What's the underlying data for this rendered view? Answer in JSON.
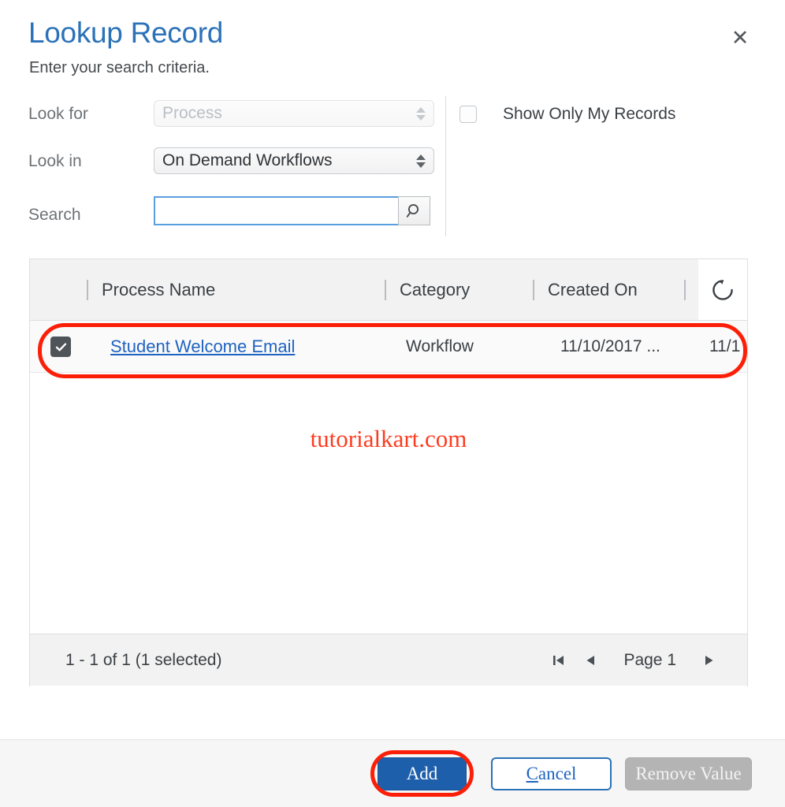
{
  "dialog": {
    "title": "Lookup Record",
    "subtitle": "Enter your search criteria.",
    "close_label": "✕"
  },
  "criteria": {
    "look_for": {
      "label": "Look for",
      "value": "Process",
      "disabled": true
    },
    "look_in": {
      "label": "Look in",
      "value": "On Demand Workflows",
      "disabled": false
    },
    "search": {
      "label": "Search",
      "value": "",
      "placeholder": ""
    },
    "show_only_my_records": {
      "label": "Show Only My Records",
      "checked": false
    }
  },
  "grid": {
    "columns": [
      "Process Name",
      "Category",
      "Created On"
    ],
    "rows": [
      {
        "selected": true,
        "process_name": "Student Welcome Email",
        "category": "Workflow",
        "created_on": "11/10/2017 ...",
        "extra": "11/1"
      }
    ],
    "refresh_icon": "refresh-icon",
    "footer": {
      "count": "1 - 1 of 1 (1 selected)",
      "page_label": "Page 1",
      "first_icon": "first-page-icon",
      "prev_icon": "previous-page-icon",
      "next_icon": "next-page-icon"
    }
  },
  "watermark": "tutorialkart.com",
  "footer_buttons": {
    "add": "Add",
    "cancel_accesskey": "C",
    "cancel_rest": "ancel",
    "remove": "Remove Value"
  },
  "colors": {
    "title_blue": "#2b72b8",
    "link_blue": "#1f63c0",
    "primary_button": "#1e5fab",
    "highlight_red": "#fc1f08",
    "watermark_red": "#fd3c20",
    "disabled_gray": "#b4b4b4"
  }
}
